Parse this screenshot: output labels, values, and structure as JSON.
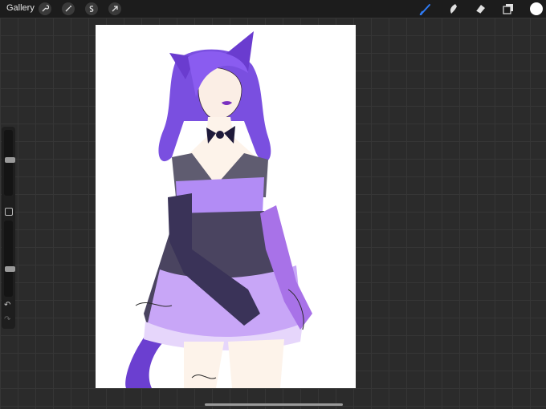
{
  "topbar": {
    "gallery_label": "Gallery",
    "left_tools": [
      "wrench-icon",
      "magic-wand-icon",
      "selection-icon",
      "transform-arrow-icon"
    ],
    "right_tools": [
      "brush-icon",
      "smudge-icon",
      "eraser-icon",
      "layers-icon"
    ],
    "active_tool": "brush-icon",
    "active_color": "#ffffff",
    "accent": "#2f7cf6"
  },
  "sidebar": {
    "brush_size_level": 0.55,
    "opacity_level": 0.35,
    "icons": [
      "modify-square-icon",
      "undo-icon",
      "redo-icon"
    ],
    "undo_glyph": "↶",
    "redo_glyph": "↷"
  },
  "canvas": {
    "background": "#ffffff",
    "artwork": "artwork"
  }
}
